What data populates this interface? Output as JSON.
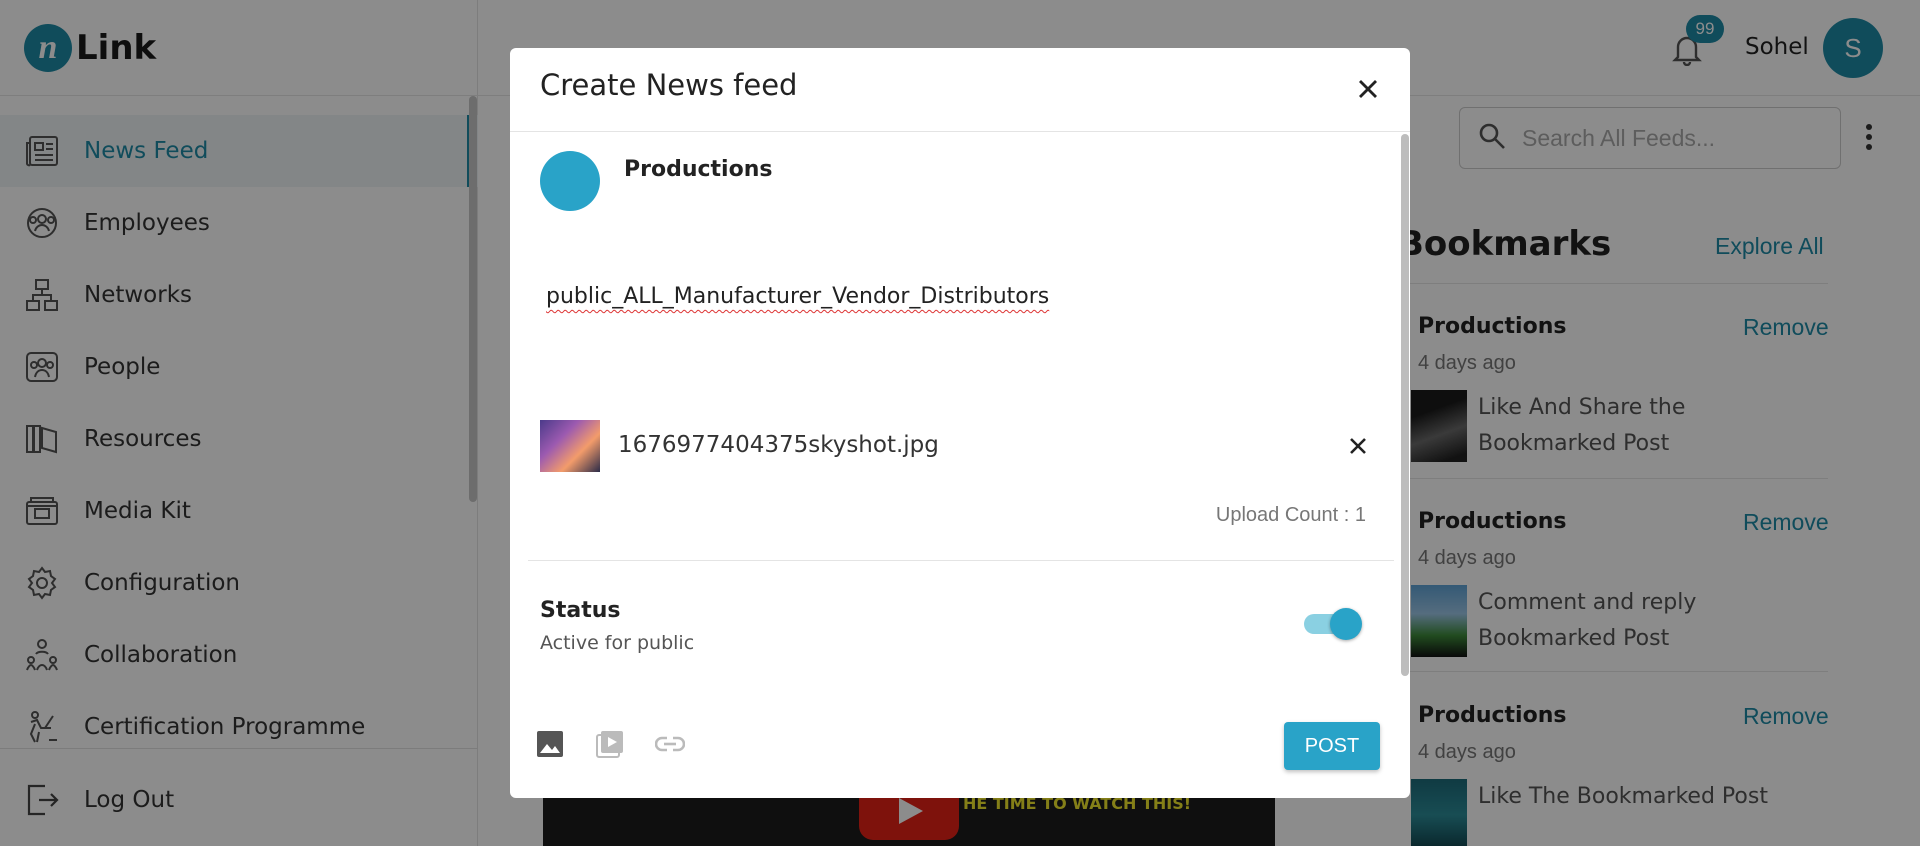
{
  "app": {
    "logo_text": "Link",
    "logo_mark": "n"
  },
  "sidebar": {
    "items": [
      {
        "label": "News Feed",
        "icon": "newspaper-icon",
        "active": true
      },
      {
        "label": "Employees",
        "icon": "employees-icon"
      },
      {
        "label": "Networks",
        "icon": "network-icon"
      },
      {
        "label": "People",
        "icon": "people-icon"
      },
      {
        "label": "Resources",
        "icon": "book-icon"
      },
      {
        "label": "Media Kit",
        "icon": "media-kit-icon"
      },
      {
        "label": "Configuration",
        "icon": "gear-icon"
      },
      {
        "label": "Collaboration",
        "icon": "collaboration-icon"
      },
      {
        "label": "Certification Programme",
        "icon": "certification-icon"
      }
    ],
    "logout_label": "Log Out"
  },
  "header": {
    "notification_count": "99",
    "user_name": "Sohel",
    "user_initial": "S"
  },
  "search": {
    "placeholder": "Search All Feeds..."
  },
  "bookmarks": {
    "title": "Bookmarks",
    "explore_label": "Explore All",
    "items": [
      {
        "name": "Productions",
        "remove_label": "Remove",
        "time": "4 days ago",
        "text": "Like And Share the Bookmarked Post"
      },
      {
        "name": "Productions",
        "remove_label": "Remove",
        "time": "4 days ago",
        "text": "Comment and reply Bookmarked Post"
      },
      {
        "name": "Productions",
        "remove_label": "Remove",
        "time": "4 days ago",
        "text": "Like The Bookmarked Post"
      }
    ]
  },
  "video": {
    "caption": "HE TIME TO WATCH THIS!"
  },
  "modal": {
    "title": "Create News feed",
    "author": "Productions",
    "post_text": "public_ALL_Manufacturer_Vendor_Distributors",
    "file_name": "1676977404375skyshot.jpg",
    "upload_count": "Upload Count : 1",
    "status_label": "Status",
    "status_sub": "Active for public",
    "status_active": true,
    "post_label": "POST",
    "colors": {
      "accent": "#29a3c8",
      "brand": "#1e8aa6"
    }
  }
}
